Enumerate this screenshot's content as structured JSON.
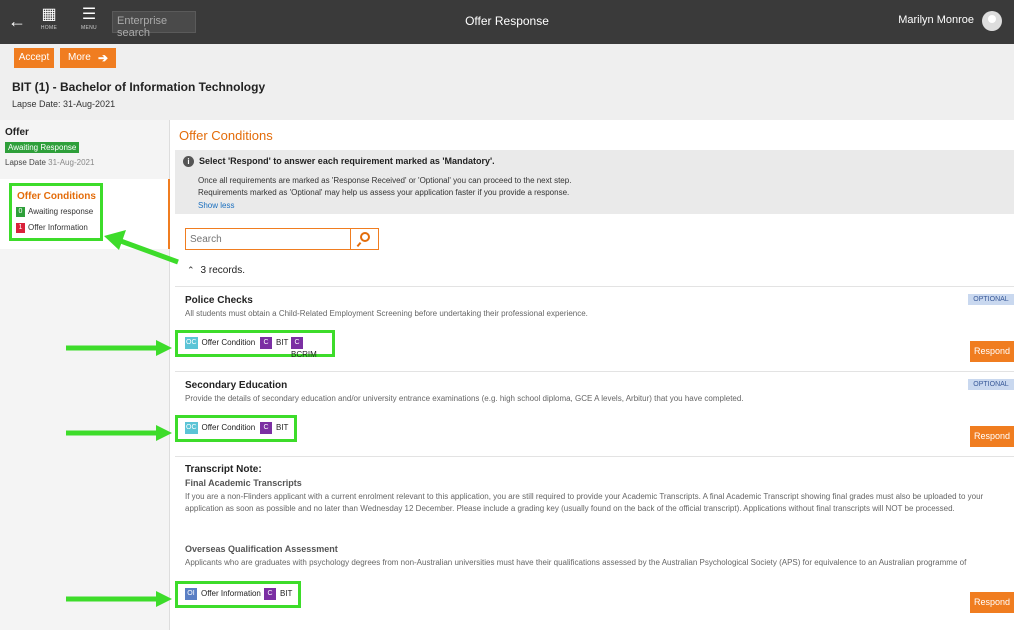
{
  "topbar": {
    "back_glyph": "←",
    "home_label": "HOME",
    "menu_label": "MENU",
    "search_placeholder": "Enterprise search",
    "page_title": "Offer Response",
    "user_name": "Marilyn Monroe"
  },
  "actions": {
    "accept_label": "Accept",
    "more_label": "More"
  },
  "header": {
    "program_title": "BIT (1) - Bachelor of Information Technology",
    "lapse_date": "Lapse Date: 31-Aug-2021"
  },
  "sidebar": {
    "offer_label": "Offer",
    "status_badge": "Awaiting Response",
    "lapse_label": "Lapse Date",
    "lapse_value": "31-Aug-2021",
    "conditions_title": "Offer Conditions",
    "items": [
      {
        "count": "0",
        "label": "Awaiting response",
        "color": "#2e9f3a"
      },
      {
        "count": "1",
        "label": "Offer Information",
        "color": "#d9213a"
      }
    ]
  },
  "main": {
    "title": "Offer Conditions",
    "info": {
      "heading": "Select 'Respond' to answer each requirement marked as 'Mandatory'.",
      "line1": "Once all requirements are marked as 'Response Received' or 'Optional' you can proceed to the next step.",
      "line2": "Requirements marked as 'Optional' may help us assess your application faster if you provide a response.",
      "toggle_link": "Show less"
    },
    "search_placeholder": "Search",
    "records_text": "3 records.",
    "respond_label": "Respond",
    "cards": [
      {
        "title": "Police Checks",
        "description": "All students must obtain a Child-Related Employment Screening before undertaking their professional experience.",
        "badge": "OPTIONAL",
        "tags": [
          {
            "code": "OC",
            "label": "Offer Condition"
          },
          {
            "code": "C",
            "label": "BIT"
          },
          {
            "code": "C",
            "label": "BCRIM"
          }
        ]
      },
      {
        "title": "Secondary Education",
        "description": "Provide the details of secondary education and/or university entrance examinations (e.g. high school diploma, GCE A levels, Arbitur) that you have completed.",
        "badge": "OPTIONAL",
        "tags": [
          {
            "code": "OC",
            "label": "Offer Condition"
          },
          {
            "code": "C",
            "label": "BIT"
          }
        ]
      },
      {
        "title": "Transcript Note:",
        "subtitle1": "Final Academic Transcripts",
        "description1": "If you are a non-Flinders applicant with a current enrolment relevant to this application, you are still required to provide your Academic Transcripts. A final Academic Transcript showing final grades must also be uploaded to your application as soon as possible and no later than Wednesday 12 December. Please include a grading key (usually found on the back of the official transcript). Applications without final transcripts will NOT be processed.",
        "subtitle2": "Overseas Qualification Assessment",
        "description2": "Applicants who are graduates with psychology degrees from non-Australian universities must have their qualifications assessed by the Australian Psychological Society (APS) for equivalence to an Australian programme of",
        "tags": [
          {
            "code": "OI",
            "label": "Offer Information"
          },
          {
            "code": "C",
            "label": "BIT"
          }
        ]
      }
    ]
  },
  "colors": {
    "accent": "#f07d20",
    "highlight": "#3ddc2a",
    "topbar": "#3a3a3a"
  }
}
